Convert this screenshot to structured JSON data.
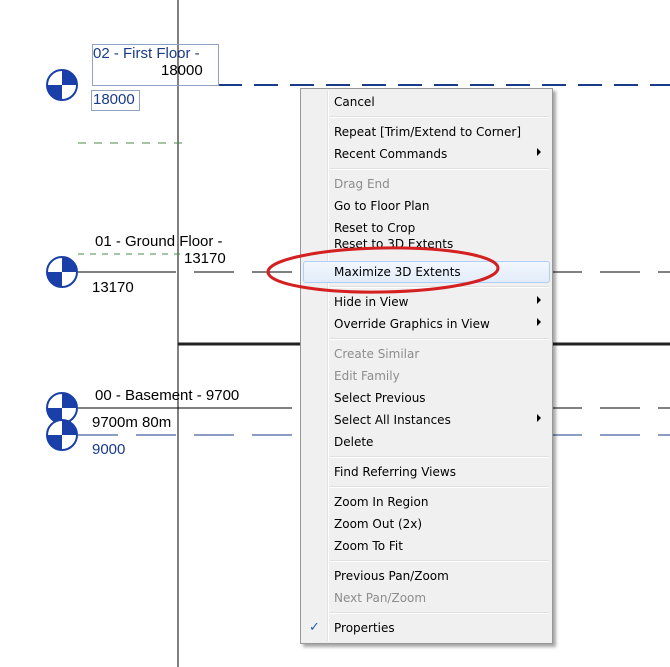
{
  "levels": {
    "first_floor_name": "02 - First Floor -",
    "first_floor_elev_top": "18000",
    "first_floor_elev": "18000",
    "ground_floor_name": "01 - Ground Floor -",
    "ground_floor_elev_top": "13170",
    "ground_floor_elev": "13170",
    "basement_name": "00 - Basement - 9700",
    "basement_elev": "9700m 80m",
    "lower_elev": "9000"
  },
  "context_menu": {
    "cancel": "Cancel",
    "repeat": "Repeat [Trim/Extend to Corner]",
    "recent_commands": "Recent Commands",
    "drag_end": "Drag End",
    "go_to_floor_plan": "Go to Floor Plan",
    "reset_to_crop": "Reset to Crop",
    "reset_to_3d_extents": "Reset to 3D Extents",
    "maximize_3d_extents": "Maximize 3D Extents",
    "hide_in_view": "Hide in View",
    "override_graphics": "Override Graphics in View",
    "create_similar": "Create Similar",
    "edit_family": "Edit Family",
    "select_previous": "Select Previous",
    "select_all_instances": "Select All Instances",
    "delete": "Delete",
    "find_referring_views": "Find Referring Views",
    "zoom_in_region": "Zoom In Region",
    "zoom_out": "Zoom Out (2x)",
    "zoom_to_fit": "Zoom To Fit",
    "previous_pan_zoom": "Previous Pan/Zoom",
    "next_pan_zoom": "Next Pan/Zoom",
    "properties": "Properties"
  },
  "colors": {
    "level_marker": "#1a3fa8",
    "highlight_ellipse": "#d42020",
    "level_line_blue": "#1a3a8a"
  }
}
